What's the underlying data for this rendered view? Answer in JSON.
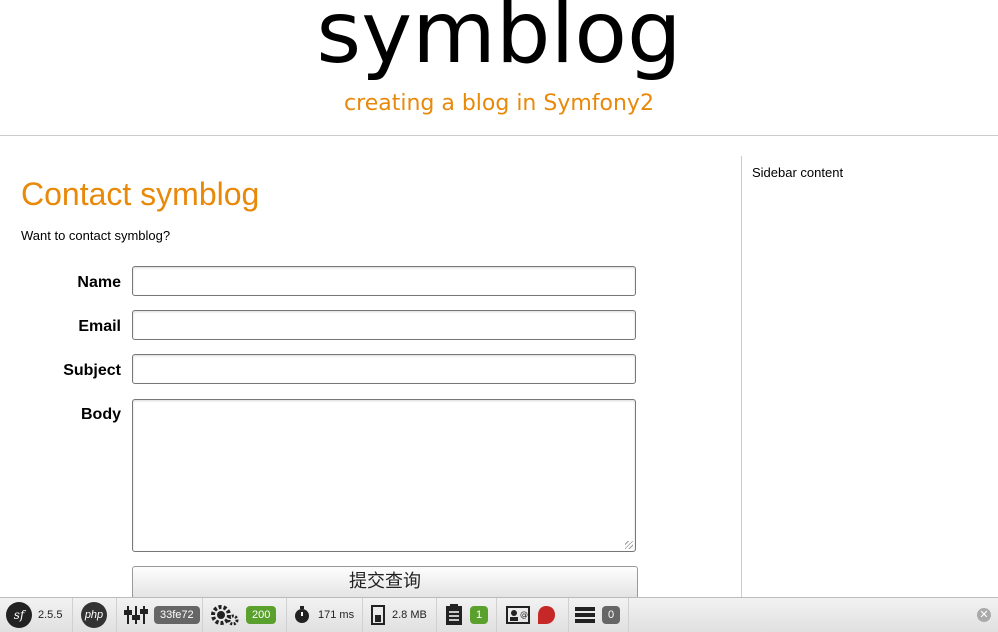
{
  "header": {
    "title": "symblog",
    "tagline": "creating a blog in Symfony2"
  },
  "main": {
    "title": "Contact symblog",
    "intro": "Want to contact symblog?",
    "form": {
      "name_label": "Name",
      "email_label": "Email",
      "subject_label": "Subject",
      "body_label": "Body",
      "name_value": "",
      "email_value": "",
      "subject_value": "",
      "body_value": "",
      "submit_label": "提交查询"
    }
  },
  "sidebar": {
    "content": "Sidebar content"
  },
  "toolbar": {
    "symfony_version": "2.5.5",
    "php_label": "php",
    "token": "33fe72",
    "status_code": "200",
    "time": "171 ms",
    "memory": "2.8 MB",
    "log_count": "1",
    "db_queries": "0",
    "close_icon": "close-icon",
    "colors": {
      "green": "#5aa02c",
      "red": "#c62828",
      "grey": "#666666"
    }
  },
  "colors": {
    "accent": "#e8890a"
  }
}
